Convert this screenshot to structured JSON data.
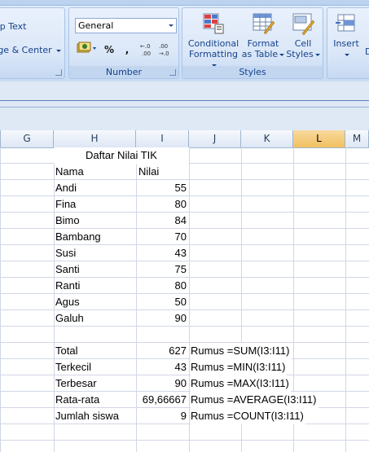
{
  "ribbon": {
    "alignment_partial": {
      "wrap_text": "ap Text",
      "merge_center": "rge & Center"
    },
    "number": {
      "format_value": "General",
      "percent": "%",
      "comma": ",",
      "increase_decimal": "+.0 .00",
      "decrease_decimal": ".00 →.0",
      "group_label": "Number"
    },
    "styles": {
      "conditional_formatting_line1": "Conditional",
      "conditional_formatting_line2": "Formatting",
      "format_as_table_line1": "Format",
      "format_as_table_line2": "as Table",
      "cell_styles_line1": "Cell",
      "cell_styles_line2": "Styles",
      "group_label": "Styles"
    },
    "cells": {
      "insert": "Insert",
      "delete_partial": "D"
    }
  },
  "sheet": {
    "columns": [
      "G",
      "H",
      "I",
      "J",
      "K",
      "L",
      "M"
    ],
    "active_column": "L",
    "title": "Daftar Nilai TIK",
    "header_name": "Nama",
    "header_value": "Nilai",
    "rows": [
      {
        "name": "Andi",
        "value": "55"
      },
      {
        "name": "Fina",
        "value": "80"
      },
      {
        "name": "Bimo",
        "value": "84"
      },
      {
        "name": "Bambang",
        "value": "70"
      },
      {
        "name": "Susi",
        "value": "43"
      },
      {
        "name": "Santi",
        "value": "75"
      },
      {
        "name": "Ranti",
        "value": "80"
      },
      {
        "name": "Agus",
        "value": "50"
      },
      {
        "name": "Galuh",
        "value": "90"
      }
    ],
    "summary": [
      {
        "label": "Total",
        "value": "627",
        "formula": "Rumus =SUM(I3:I11)"
      },
      {
        "label": "Terkecil",
        "value": "43",
        "formula": "Rumus =MIN(I3:I11)"
      },
      {
        "label": "Terbesar",
        "value": "90",
        "formula": "Rumus =MAX(I3:I11)"
      },
      {
        "label": "Rata-rata",
        "value": "69,66667",
        "formula": "Rumus =AVERAGE(I3:I11)"
      },
      {
        "label": "Jumlah siswa",
        "value": "9",
        "formula": "Rumus =COUNT(I3:I11)"
      }
    ]
  }
}
